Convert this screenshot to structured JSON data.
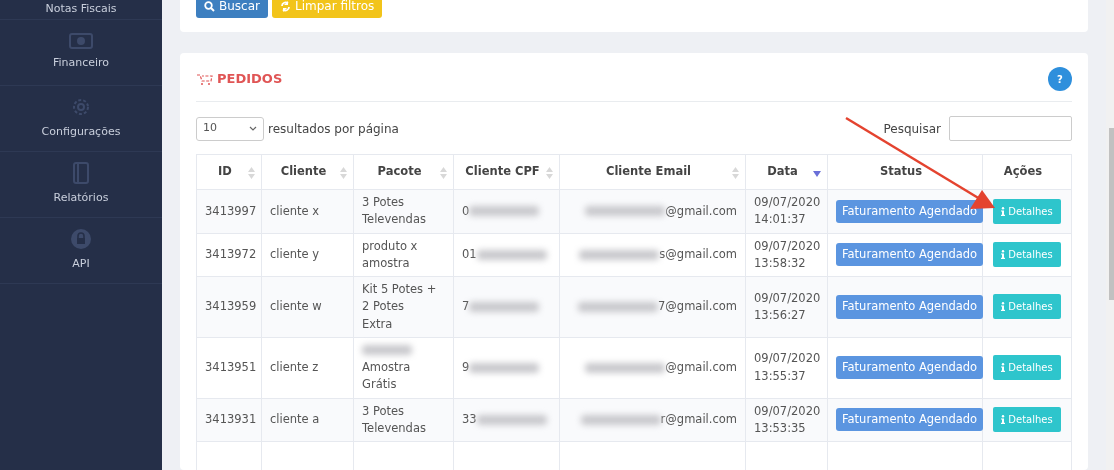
{
  "sidebar": {
    "items": [
      {
        "label": "Notas Fiscais",
        "kind": "plain"
      },
      {
        "label": "Financeiro",
        "kind": "money"
      },
      {
        "label": "Configurações",
        "kind": "gear"
      },
      {
        "label": "Relatórios",
        "kind": "book"
      },
      {
        "label": "API",
        "kind": "lock"
      }
    ]
  },
  "filters": {
    "buttons": [
      {
        "label": "Buscar",
        "kind": "search"
      },
      {
        "label": "Limpar filtros",
        "kind": "reset"
      }
    ]
  },
  "orders": {
    "title": "PEDIDOS",
    "help": "?",
    "page_size": "10",
    "page_size_label": "resultados por página",
    "search_label": "Pesquisar",
    "table": {
      "columns": [
        {
          "label": "ID",
          "kind": "sortable"
        },
        {
          "label": "Cliente",
          "kind": "sortable"
        },
        {
          "label": "Pacote",
          "kind": "sortable"
        },
        {
          "label": "Cliente CPF",
          "kind": "sortable"
        },
        {
          "label": "Cliente Email",
          "kind": "sortable"
        },
        {
          "label": "Data",
          "kind": "sorted"
        },
        {
          "label": "Status",
          "kind": "plain"
        },
        {
          "label": "Ações",
          "kind": "plain"
        }
      ],
      "rows": [
        {
          "id": "3413997",
          "client": "cliente x",
          "package": [
            "3 Potes",
            "Televendas"
          ],
          "cpf": "0",
          "email": "@gmail.com",
          "date": "09/07/2020",
          "time": "14:01:37",
          "status": "Faturamento Agendado",
          "action": "Detalhes"
        },
        {
          "id": "3413972",
          "client": "cliente y",
          "package": [
            "produto x",
            "amostra"
          ],
          "cpf": "01",
          "email": "s@gmail.com",
          "date": "09/07/2020",
          "time": "13:58:32",
          "status": "Faturamento Agendado",
          "action": "Detalhes"
        },
        {
          "id": "3413959",
          "client": "cliente w",
          "package": [
            "Kit 5 Potes +",
            "2 Potes",
            "Extra"
          ],
          "cpf": "7",
          "email": "7@gmail.com",
          "date": "09/07/2020",
          "time": "13:56:27",
          "status": "Faturamento Agendado",
          "action": "Detalhes"
        },
        {
          "id": "3413951",
          "client": "cliente z",
          "package": [
            "Amostra",
            "Grátis"
          ],
          "package_blurred_line": true,
          "cpf": "9",
          "email": "@gmail.com",
          "date": "09/07/2020",
          "time": "13:55:37",
          "status": "Faturamento Agendado",
          "action": "Detalhes"
        },
        {
          "id": "3413931",
          "client": "cliente a",
          "package": [
            "3 Potes",
            "Televendas"
          ],
          "cpf": "33",
          "email": "r@gmail.com",
          "date": "09/07/2020",
          "time": "13:53:35",
          "status": "Faturamento Agendado",
          "action": "Detalhes"
        }
      ]
    }
  }
}
